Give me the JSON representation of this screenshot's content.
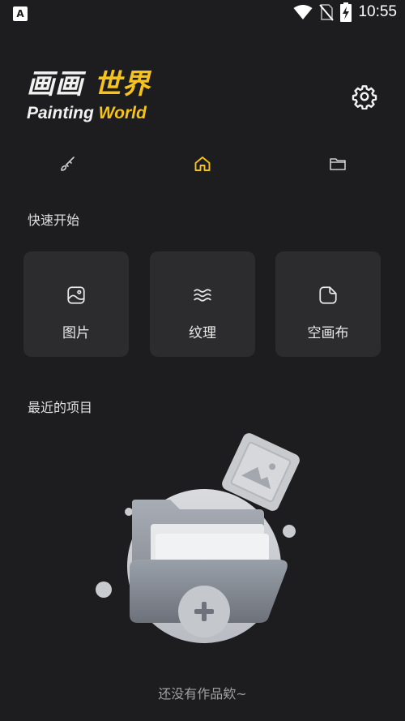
{
  "status_bar": {
    "left_icon": "A",
    "time": "10:55",
    "icons": [
      "wifi-icon",
      "no-sim-icon",
      "battery-charging-icon"
    ]
  },
  "logo": {
    "cn_part1": "画画",
    "cn_part2": "世界",
    "en_part1": "Painting ",
    "en_part2": "World"
  },
  "header": {
    "settings_icon": "gear-icon"
  },
  "tabs": [
    {
      "icon": "brush-icon",
      "active": false
    },
    {
      "icon": "home-icon",
      "active": true
    },
    {
      "icon": "folder-icon",
      "active": false
    }
  ],
  "quick_start": {
    "title": "快速开始",
    "cards": [
      {
        "label": "图片",
        "icon": "image-icon"
      },
      {
        "label": "纹理",
        "icon": "texture-icon"
      },
      {
        "label": "空画布",
        "icon": "blank-canvas-icon"
      }
    ]
  },
  "recent": {
    "title": "最近的项目",
    "empty_text": "还没有作品欸~"
  },
  "colors": {
    "background": "#1d1d1f",
    "card": "#2c2c2e",
    "accent": "#f6c21c"
  }
}
